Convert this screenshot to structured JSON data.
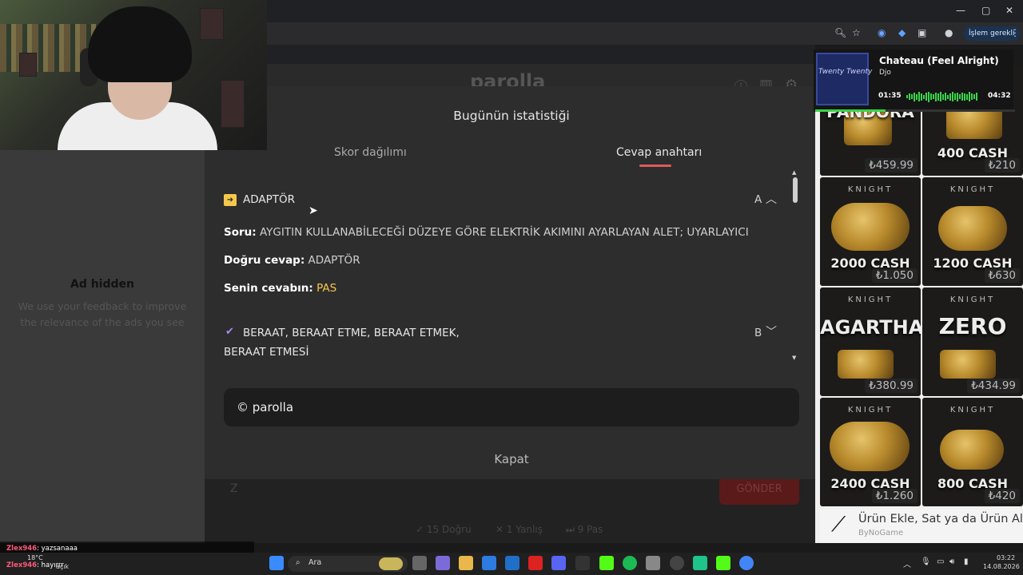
{
  "browser": {
    "window_controls": [
      "—",
      "▢",
      "✕"
    ],
    "toolbar_icons": [
      "zoom-icon",
      "star-icon",
      "extension-icon",
      "puzzle-icon",
      "profile-icon"
    ],
    "action_badge": "İşlem gerekli",
    "menu_icon": "⋮"
  },
  "page": {
    "logo": "parolla",
    "ad": {
      "title": "Ad hidden",
      "text": "We use your feedback to improve the relevance of the ads you see"
    },
    "send_button": "GÖNDER",
    "stats_line": [
      "✓ 15 Doğru",
      "✕ 1 Yanlış",
      "⏭ 9 Pas"
    ]
  },
  "modal": {
    "title": "Bugünün istatistiği",
    "tabs": [
      {
        "label": "Skor dağılımı",
        "active": false
      },
      {
        "label": "Cevap anahtarı",
        "active": true
      }
    ],
    "items": [
      {
        "word": "ADAPTÖR",
        "letter": "A",
        "expanded": true,
        "status_icon": "arrow-right-icon",
        "question_label": "Soru:",
        "question": "AYGITIN KULLANABİLECEĞİ DÜZEYE GÖRE ELEKTRİK AKIMINI AYARLAYAN ALET; UYARLAYICI",
        "correct_label": "Doğru cevap:",
        "correct": "ADAPTÖR",
        "yours_label": "Senin cevabın:",
        "yours": "PAS"
      },
      {
        "word_line1": "BERAAT, BERAAT ETME, BERAAT ETMEK,",
        "word_line2": "BERAAT ETMESİ",
        "letter": "B",
        "expanded": false,
        "status_icon": "check-icon"
      }
    ],
    "footer": "© parolla",
    "close": "Kapat"
  },
  "store": {
    "brand": "KNIGHT",
    "cards": [
      {
        "name": "PANDORA",
        "price": "₺459.99"
      },
      {
        "name": "400 CASH",
        "price": "₺210"
      },
      {
        "name": "2000 CASH",
        "price": "₺1.050"
      },
      {
        "name": "1200 CASH",
        "price": "₺630"
      },
      {
        "name": "AGARTHA",
        "price": "₺380.99"
      },
      {
        "name": "ZERO",
        "price": "₺434.99"
      },
      {
        "name": "2400 CASH",
        "price": "₺1.260"
      },
      {
        "name": "800 CASH",
        "price": "₺420"
      }
    ],
    "product_bar": {
      "title": "Ürün Ekle, Sat ya da Ürün Al",
      "sub": "ByNoGame"
    }
  },
  "spotify": {
    "title": "Chateau (Feel Alright)",
    "artist": "Djo",
    "elapsed": "01:35",
    "duration": "04:32",
    "progress_fraction": 0.35,
    "album_art_text": "Twenty Twenty"
  },
  "chat": [
    {
      "user": "Zlex946",
      "message": ": yazsanaaa"
    },
    {
      "user": "Zlex946",
      "message": ": hayırrr"
    }
  ],
  "taskbar": {
    "search_label": "Ara",
    "weather": "18°C",
    "weather_note": "açık",
    "time": "03:22",
    "date": "14.08.2026"
  },
  "colors": {
    "accent_red": "#e05a5a",
    "pas_yellow": "#f5c84c",
    "check_purple": "#a98bf0",
    "spotify_green": "#3ad54b"
  }
}
